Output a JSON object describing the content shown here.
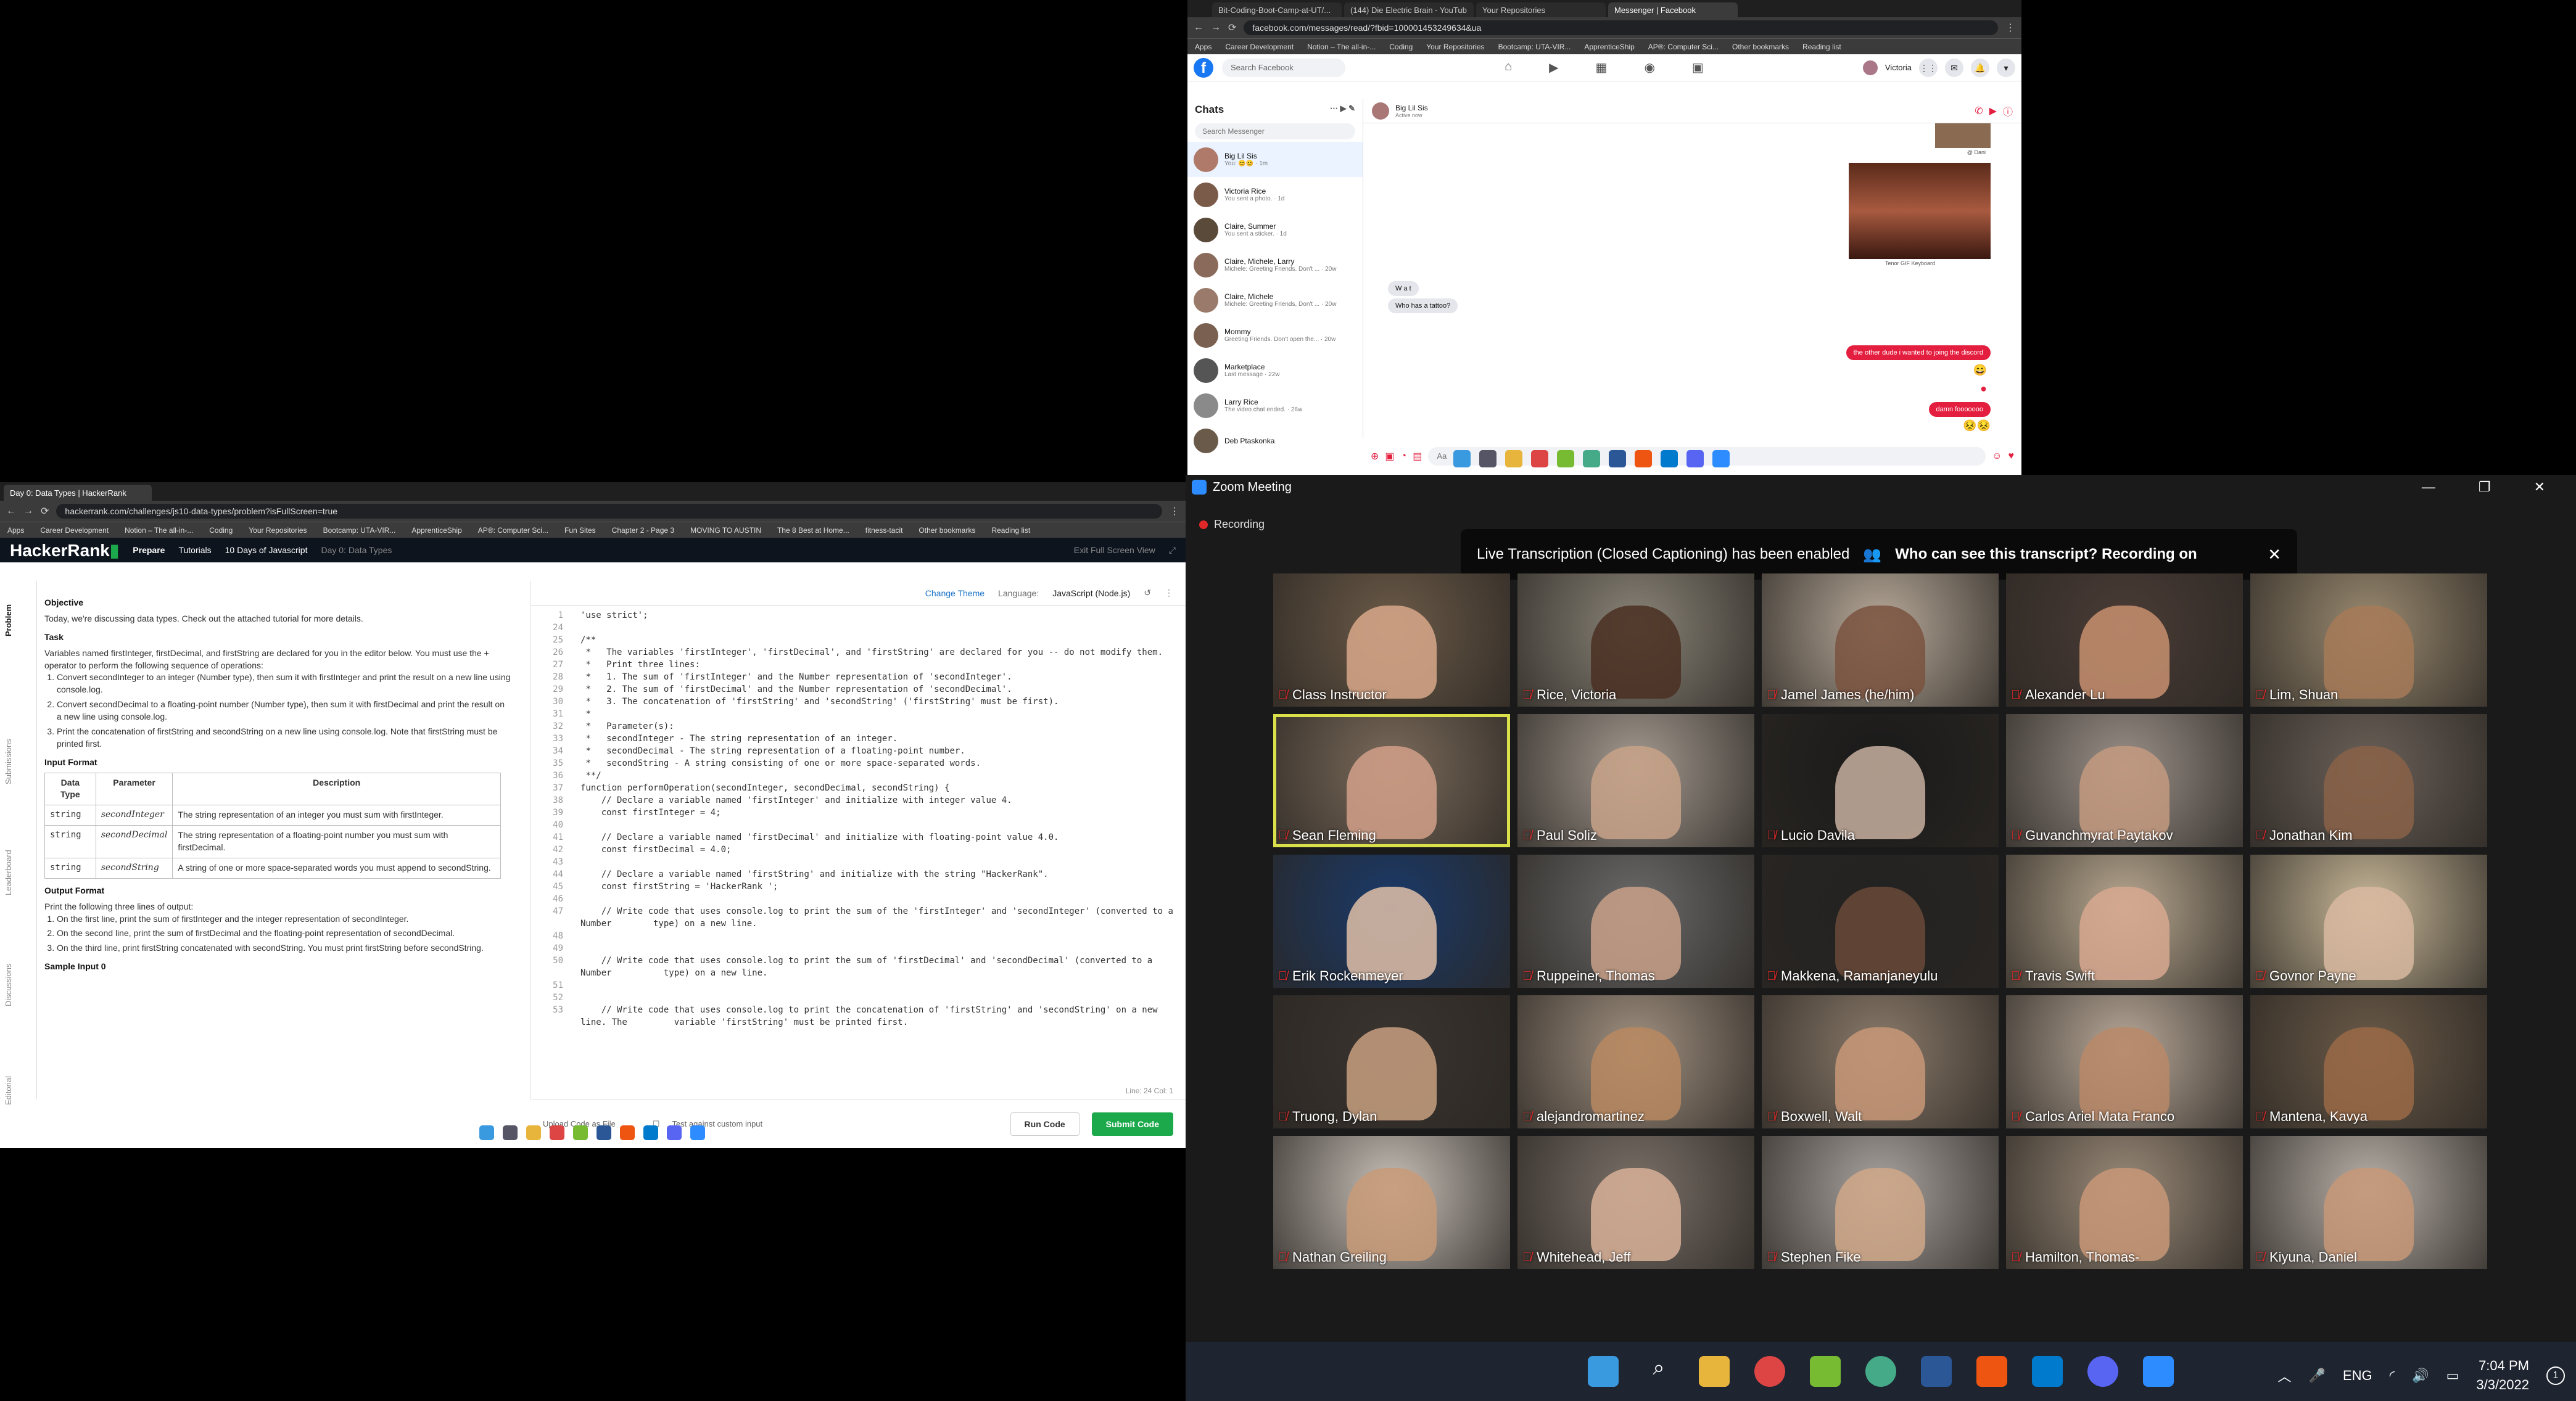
{
  "messenger": {
    "tabs": [
      "Bit-Coding-Boot-Camp-at-UT/...",
      "(144) Die Electric Brain - YouTub",
      "Your Repositories",
      "Messenger | Facebook"
    ],
    "url": "facebook.com/messages/read/?fbid=100001453249634&ua",
    "bookmarks": [
      "Apps",
      "Career Development",
      "Notion – The all-in-...",
      "Coding",
      "Your Repositories",
      "Bootcamp: UTA-VIR...",
      "ApprenticeShip",
      "AP®: Computer Sci...",
      "Other bookmarks",
      "Reading list"
    ],
    "search_placeholder": "Search Facebook",
    "account_name": "Victoria",
    "chats_title": "Chats",
    "messenger_search": "Search Messenger",
    "chats": [
      {
        "name": "Big Lil Sis",
        "preview": "You: 😊😊 · 1m"
      },
      {
        "name": "Victoria Rice",
        "preview": "You sent a photo. · 1d"
      },
      {
        "name": "Claire, Summer",
        "preview": "You sent a sticker. · 1d"
      },
      {
        "name": "Claire, Michele, Larry",
        "preview": "Michele: Greeting Friends. Don't ... · 20w"
      },
      {
        "name": "Claire, Michele",
        "preview": "Michele: Greeting Friends, Don't ... · 20w"
      },
      {
        "name": "Mommy",
        "preview": "Greeting Friends. Don't open the... · 20w"
      },
      {
        "name": "Marketplace",
        "preview": "Last message · 22w"
      },
      {
        "name": "Larry Rice",
        "preview": "The video chat ended. · 26w"
      },
      {
        "name": "Deb Ptaskonka",
        "preview": ""
      }
    ],
    "conversation": {
      "name": "Big Lil Sis",
      "status": "Active now",
      "gif_caption": "Tenor GIF Keyboard",
      "gif_caption_top": "@ Dani",
      "incoming": [
        "W a t",
        "Who has a tattoo?"
      ],
      "outgoing": [
        "the other dude i wanted to joing the discord",
        "damn fooooooo"
      ],
      "compose_placeholder": "Aa"
    }
  },
  "hackerrank": {
    "tab": "Day 0: Data Types | HackerRank",
    "url": "hackerrank.com/challenges/js10-data-types/problem?isFullScreen=true",
    "bookmarks": [
      "Apps",
      "Career Development",
      "Notion – The all-in-...",
      "Coding",
      "Your Repositories",
      "Bootcamp: UTA-VIR...",
      "ApprenticeShip",
      "AP®: Computer Sci...",
      "Fun Sites",
      "Chapter 2 - Page 3",
      "MOVING TO AUSTIN",
      "The 8 Best at Home...",
      "fitness-tacit",
      "Other bookmarks",
      "Reading list"
    ],
    "brand": "HackerRank",
    "nav": [
      "Prepare",
      "Tutorials",
      "10 Days of Javascript",
      "Day 0: Data Types"
    ],
    "exit_full": "Exit Full Screen View",
    "side_tabs": [
      "Problem",
      "Submissions",
      "Leaderboard",
      "Discussions",
      "Editorial"
    ],
    "objective_title": "Objective",
    "objective": "Today, we're discussing data types. Check out the attached tutorial for more details.",
    "task_title": "Task",
    "task_intro": "Variables named firstInteger, firstDecimal, and firstString are declared for you in the editor below. You must use the + operator to perform the following sequence of operations:",
    "task_items": [
      "Convert secondInteger to an integer (Number type), then sum it with firstInteger and print the result on a new line using console.log.",
      "Convert secondDecimal to a floating-point number (Number type), then sum it with firstDecimal and print the result on a new line using console.log.",
      "Print the concatenation of firstString and secondString on a new line using console.log. Note that firstString must be printed first."
    ],
    "input_title": "Input Format",
    "table_headers": [
      "Data Type",
      "Parameter",
      "Description"
    ],
    "table_rows": [
      [
        "string",
        "secondInteger",
        "The string representation of an integer you must sum with firstInteger."
      ],
      [
        "string",
        "secondDecimal",
        "The string representation of a floating-point number you must sum with firstDecimal."
      ],
      [
        "string",
        "secondString",
        "A string of one or more space-separated words you must append to secondString."
      ]
    ],
    "output_title": "Output Format",
    "output_intro": "Print the following three lines of output:",
    "output_items": [
      "On the first line, print the sum of firstInteger and the integer representation of secondInteger.",
      "On the second line, print the sum of firstDecimal and the floating-point representation of secondDecimal.",
      "On the third line, print firstString concatenated with secondString. You must print firstString before secondString."
    ],
    "sample_title": "Sample Input 0",
    "change_theme": "Change Theme",
    "language_label": "Language:",
    "language": "JavaScript (Node.js)",
    "code_lines": [
      {
        "n": "1",
        "t": "'use strict';",
        "c": "str"
      },
      {
        "n": "24",
        "t": "",
        "c": ""
      },
      {
        "n": "25",
        "t": "/**",
        "c": "cm"
      },
      {
        "n": "26",
        "t": " *   The variables 'firstInteger', 'firstDecimal', and 'firstString' are declared for you -- do not modify them.",
        "c": "cm"
      },
      {
        "n": "27",
        "t": " *   Print three lines:",
        "c": "cm"
      },
      {
        "n": "28",
        "t": " *   1. The sum of 'firstInteger' and the Number representation of 'secondInteger'.",
        "c": "cm"
      },
      {
        "n": "29",
        "t": " *   2. The sum of 'firstDecimal' and the Number representation of 'secondDecimal'.",
        "c": "cm"
      },
      {
        "n": "30",
        "t": " *   3. The concatenation of 'firstString' and 'secondString' ('firstString' must be first).",
        "c": "cm"
      },
      {
        "n": "31",
        "t": " *",
        "c": "cm"
      },
      {
        "n": "32",
        "t": " *   Parameter(s):",
        "c": "cm"
      },
      {
        "n": "33",
        "t": " *   secondInteger - The string representation of an integer.",
        "c": "cm"
      },
      {
        "n": "34",
        "t": " *   secondDecimal - The string representation of a floating-point number.",
        "c": "cm"
      },
      {
        "n": "35",
        "t": " *   secondString - A string consisting of one or more space-separated words.",
        "c": "cm"
      },
      {
        "n": "36",
        "t": " **/",
        "c": "cm"
      },
      {
        "n": "37",
        "t": "function performOperation(secondInteger, secondDecimal, secondString) {",
        "c": "kw"
      },
      {
        "n": "38",
        "t": "    // Declare a variable named 'firstInteger' and initialize with integer value 4.",
        "c": "cm"
      },
      {
        "n": "39",
        "t": "    const firstInteger = 4;",
        "c": "kw"
      },
      {
        "n": "40",
        "t": "",
        "c": ""
      },
      {
        "n": "41",
        "t": "    // Declare a variable named 'firstDecimal' and initialize with floating-point value 4.0.",
        "c": "cm"
      },
      {
        "n": "42",
        "t": "    const firstDecimal = 4.0;",
        "c": "kw"
      },
      {
        "n": "43",
        "t": "",
        "c": ""
      },
      {
        "n": "44",
        "t": "    // Declare a variable named 'firstString' and initialize with the string \"HackerRank\".",
        "c": "cm"
      },
      {
        "n": "45",
        "t": "    const firstString = 'HackerRank ';",
        "c": "kw"
      },
      {
        "n": "46",
        "t": "",
        "c": ""
      },
      {
        "n": "47",
        "t": "    // Write code that uses console.log to print the sum of the 'firstInteger' and 'secondInteger' (converted to a Number        type) on a new line.",
        "c": "cm"
      },
      {
        "n": "48",
        "t": "",
        "c": ""
      },
      {
        "n": "49",
        "t": "",
        "c": ""
      },
      {
        "n": "50",
        "t": "    // Write code that uses console.log to print the sum of 'firstDecimal' and 'secondDecimal' (converted to a Number          type) on a new line.",
        "c": "cm"
      },
      {
        "n": "51",
        "t": "",
        "c": ""
      },
      {
        "n": "52",
        "t": "",
        "c": ""
      },
      {
        "n": "53",
        "t": "    // Write code that uses console.log to print the concatenation of 'firstString' and 'secondString' on a new line. The         variable 'firstString' must be printed first.",
        "c": "cm"
      }
    ],
    "cursor_status": "Line: 24 Col: 1",
    "upload": "Upload Code as File",
    "custom_input": "Test against custom input",
    "run": "Run Code",
    "submit": "Submit Code"
  },
  "zoom": {
    "title": "Zoom Meeting",
    "recording": "Recording",
    "banner_text": "Live Transcription (Closed Captioning) has been enabled",
    "banner_link": "Who can see this transcript? Recording on",
    "participants": [
      {
        "name": "Class Instructor",
        "bg": "#6b5a48",
        "skin": "#d8a88a"
      },
      {
        "name": "Rice, Victoria",
        "bg": "#8a8478",
        "skin": "#4a2f22"
      },
      {
        "name": "Jamel James (he/him)",
        "bg": "#b8aa9a",
        "skin": "#7a5240"
      },
      {
        "name": "Alexander Lu",
        "bg": "#4a3c36",
        "skin": "#c89070"
      },
      {
        "name": "Lim, Shuan",
        "bg": "#9a8a70",
        "skin": "#a67a58"
      },
      {
        "name": "Sean Fleming",
        "bg": "#7a6a5a",
        "skin": "#d2a08a"
      },
      {
        "name": "Paul Soliz",
        "bg": "#a49a90",
        "skin": "#c8a288"
      },
      {
        "name": "Lucio Davila",
        "bg": "#1a1a1a",
        "skin": "#c8b0a0"
      },
      {
        "name": "Guvanchmyrat Paytakov",
        "bg": "#9a9088",
        "skin": "#c49a80"
      },
      {
        "name": "Jonathan Kim",
        "bg": "#6a6058",
        "skin": "#8a6248"
      },
      {
        "name": "Erik Rockenmeyer",
        "bg": "#1a3a6a",
        "skin": "#e0c0a8"
      },
      {
        "name": "Ruppeiner, Thomas",
        "bg": "#6a6a6a",
        "skin": "#c8a088"
      },
      {
        "name": "Makkena, Ramanjaneyulu",
        "bg": "#222222",
        "skin": "#6a4a38"
      },
      {
        "name": "Travis Swift",
        "bg": "#b8a890",
        "skin": "#d8a890"
      },
      {
        "name": "Govnor Payne",
        "bg": "#c8b898",
        "skin": "#d8b8a0"
      },
      {
        "name": "Truong, Dylan",
        "bg": "#3a3430",
        "skin": "#c8a080"
      },
      {
        "name": "alejandromartinez",
        "bg": "#a09080",
        "skin": "#b88860"
      },
      {
        "name": "Boxwell, Walt",
        "bg": "#8a7a6a",
        "skin": "#c89878"
      },
      {
        "name": "Carlos Ariel Mata Franco",
        "bg": "#b8a898",
        "skin": "#b88868"
      },
      {
        "name": "Mantena, Kavya",
        "bg": "#6a5a48",
        "skin": "#9a6a48"
      },
      {
        "name": "Nathan Greiling",
        "bg": "#c8c0b8",
        "skin": "#c89a78"
      },
      {
        "name": "Whitehead, Jeff",
        "bg": "#7a7068",
        "skin": "#d8b098"
      },
      {
        "name": "Stephen Fike",
        "bg": "#aaa4a0",
        "skin": "#d0a888"
      },
      {
        "name": "Hamilton, Thomas-",
        "bg": "#9a8a78",
        "skin": "#c89878"
      },
      {
        "name": "Kiyuna, Daniel",
        "bg": "#b8b0a8",
        "skin": "#c89878"
      }
    ]
  },
  "taskbar": {
    "language": "ENG",
    "time": "7:04 PM",
    "date": "3/3/2022",
    "notifications": "1"
  }
}
